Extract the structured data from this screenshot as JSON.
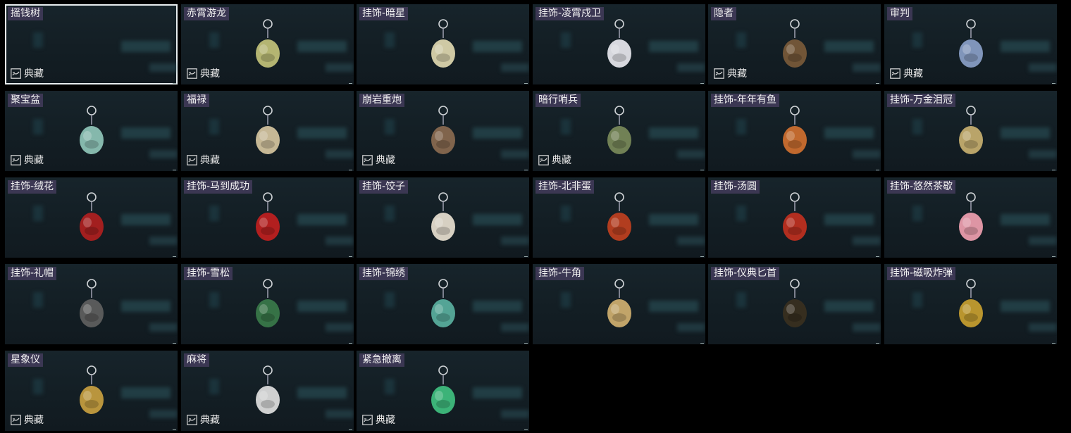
{
  "grid": {
    "items": [
      {
        "name": "摇钱树",
        "collection": "典藏",
        "selected": true,
        "icon": "money-tree-empty",
        "color": "#000000"
      },
      {
        "name": "赤霄游龙",
        "collection": "典藏",
        "icon": "dragon-figure-icon",
        "color": "#c2c27a"
      },
      {
        "name": "挂饰-暗星",
        "collection": "",
        "icon": "dark-star-pendant-icon",
        "color": "#e0d8b0"
      },
      {
        "name": "挂饰-凌霄戍卫",
        "collection": "",
        "icon": "rocket-pendant-icon",
        "color": "#e8e8ef"
      },
      {
        "name": "隐者",
        "collection": "典藏",
        "icon": "hermit-card-icon",
        "color": "#7a5a3a"
      },
      {
        "name": "审判",
        "collection": "典藏",
        "icon": "judgement-card-icon",
        "color": "#8aa0c8"
      },
      {
        "name": "聚宝盆",
        "collection": "典藏",
        "icon": "treasure-bowl-icon",
        "color": "#8fc6b8"
      },
      {
        "name": "福禄",
        "collection": "典藏",
        "icon": "gourd-icon",
        "color": "#d6c6a0"
      },
      {
        "name": "崩岩重炮",
        "collection": "典藏",
        "icon": "cannon-figure-icon",
        "color": "#8a6a50"
      },
      {
        "name": "暗行哨兵",
        "collection": "典藏",
        "icon": "sentinel-figure-icon",
        "color": "#7a8a5a"
      },
      {
        "name": "挂饰-年年有鱼",
        "collection": "",
        "icon": "fish-plate-icon",
        "color": "#d07030"
      },
      {
        "name": "挂饰-万金泪冠",
        "collection": "",
        "icon": "crown-pendant-icon",
        "color": "#c8b070"
      },
      {
        "name": "挂饰-绒花",
        "collection": "",
        "icon": "velvet-flower-icon",
        "color": "#b02020"
      },
      {
        "name": "挂饰-马到成功",
        "collection": "",
        "icon": "horse-pendant-icon",
        "color": "#c02020"
      },
      {
        "name": "挂饰-饺子",
        "collection": "",
        "icon": "dumpling-plate-icon",
        "color": "#e8e0d0"
      },
      {
        "name": "挂饰-北非蛋",
        "collection": "",
        "icon": "shakshuka-pan-icon",
        "color": "#c04020"
      },
      {
        "name": "挂饰-汤圆",
        "collection": "",
        "icon": "tangyuan-bowl-icon",
        "color": "#c03020"
      },
      {
        "name": "挂饰-悠然茶歇",
        "collection": "",
        "icon": "cupcake-pendant-icon",
        "color": "#f0a0b0"
      },
      {
        "name": "挂饰-礼帽",
        "collection": "",
        "icon": "top-hat-icon",
        "color": "#606060"
      },
      {
        "name": "挂饰-雪松",
        "collection": "",
        "icon": "snow-pine-icon",
        "color": "#3a7a4a"
      },
      {
        "name": "挂饰-锦绣",
        "collection": "",
        "icon": "butterfly-icon",
        "color": "#5ab0a0"
      },
      {
        "name": "挂饰-牛角",
        "collection": "",
        "icon": "bull-horn-icon",
        "color": "#d0b070"
      },
      {
        "name": "挂饰-仪典匕首",
        "collection": "",
        "icon": "dagger-icon",
        "color": "#3a3020"
      },
      {
        "name": "挂饰-磁吸炸弹",
        "collection": "",
        "icon": "magnetic-bomb-icon",
        "color": "#c8a030"
      },
      {
        "name": "星象仪",
        "collection": "典藏",
        "icon": "astrolabe-icon",
        "color": "#c8a040"
      },
      {
        "name": "麻将",
        "collection": "典藏",
        "icon": "mahjong-tile-icon",
        "color": "#e0e0e0"
      },
      {
        "name": "紧急撤离",
        "collection": "典藏",
        "icon": "emergency-exit-sign-icon",
        "color": "#40c080"
      }
    ]
  }
}
